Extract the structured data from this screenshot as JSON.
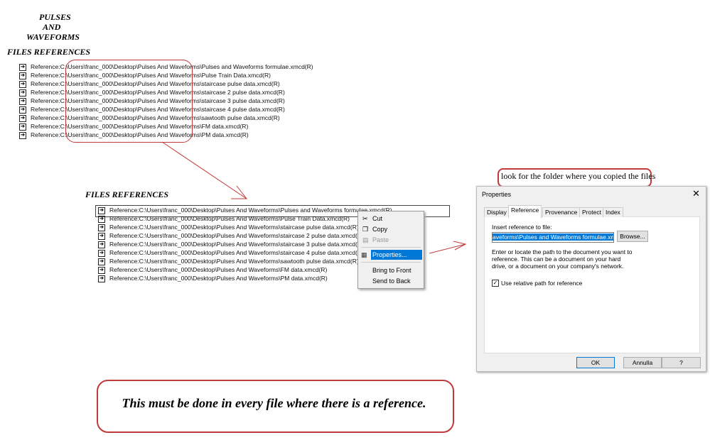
{
  "title_lines": [
    "PULSES",
    "AND",
    "WAVEFORMS"
  ],
  "section_heading": "FILES REFERENCES",
  "references": [
    "Reference:C:\\Users\\franc_000\\Desktop\\Pulses And Waveforms\\Pulses and Waveforms formulae.xmcd(R)",
    "Reference:C:\\Users\\franc_000\\Desktop\\Pulses And Waveforms\\Pulse Train  Data.xmcd(R)",
    "Reference:C:\\Users\\franc_000\\Desktop\\Pulses And Waveforms\\staircase pulse data.xmcd(R)",
    "Reference:C:\\Users\\franc_000\\Desktop\\Pulses And Waveforms\\staircase 2 pulse data.xmcd(R)",
    "Reference:C:\\Users\\franc_000\\Desktop\\Pulses And Waveforms\\staircase 3 pulse data.xmcd(R)",
    "Reference:C:\\Users\\franc_000\\Desktop\\Pulses And Waveforms\\staircase 4 pulse data.xmcd(R)",
    "Reference:C:\\Users\\franc_000\\Desktop\\Pulses And Waveforms\\sawtooth pulse data.xmcd(R)",
    "Reference:C:\\Users\\franc_000\\Desktop\\Pulses And Waveforms\\FM data.xmcd(R)",
    "Reference:C:\\Users\\franc_000\\Desktop\\Pulses And Waveforms\\PM data.xmcd(R)"
  ],
  "reference_icon": "arrow-right-box-icon",
  "context_menu": {
    "items": [
      {
        "label": "Cut",
        "icon": "scissors-icon"
      },
      {
        "label": "Copy",
        "icon": "copy-icon"
      },
      {
        "label": "Paste",
        "icon": "paste-icon",
        "disabled": true
      },
      {
        "label": "Properties...",
        "icon": "properties-icon",
        "highlighted": true
      },
      {
        "label": "Bring to Front"
      },
      {
        "label": "Send to Back"
      }
    ]
  },
  "note": "look for the folder where you copied the files",
  "dialog": {
    "title": "Properties",
    "tabs": [
      "Display",
      "Reference",
      "Provenance",
      "Protect",
      "Index"
    ],
    "active_tab": "Reference",
    "field_label": "Insert reference to file:",
    "field_value": "aveforms\\Pulses and Waveforms formulae.xmcd",
    "browse": "Browse...",
    "description": "Enter or locate the path to the document you want to reference. This can be a document on your hard drive, or a document on your company's network.",
    "checkbox_label": "Use relative path for reference",
    "checkbox_checked": true,
    "ok": "OK",
    "cancel": "Annulla",
    "help": "?"
  },
  "footer_note": "This must be done in every file where there is a reference.",
  "colors": {
    "annotation_red": "#c0393b",
    "highlight": "#0078d7"
  }
}
